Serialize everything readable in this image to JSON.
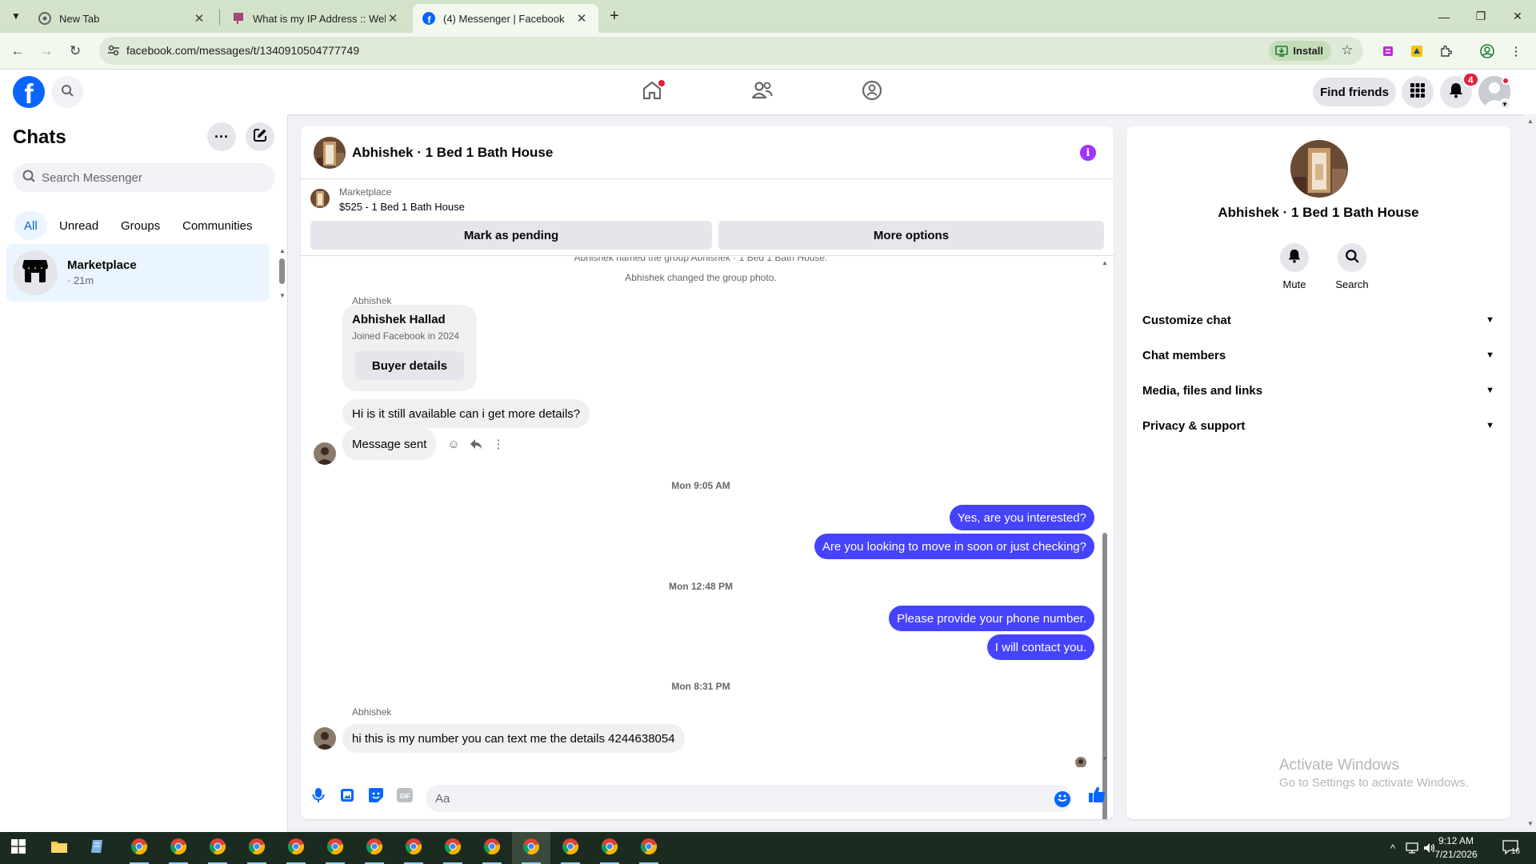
{
  "browser": {
    "tabs": [
      {
        "title": "New Tab",
        "icon": "chrome-icon"
      },
      {
        "title": "What is my IP Address :: WebBrowserTools",
        "icon": "webpage-icon"
      },
      {
        "title": "(4) Messenger | Facebook",
        "icon": "facebook-icon",
        "active": true
      }
    ],
    "url": "facebook.com/messages/t/1340910504777749",
    "install_label": "Install"
  },
  "fb_header": {
    "find_friends": "Find friends",
    "notification_count": "4"
  },
  "sidebar": {
    "title": "Chats",
    "search_placeholder": "Search Messenger",
    "filters": [
      "All",
      "Unread",
      "Groups",
      "Communities"
    ],
    "active_filter": "All",
    "chats": [
      {
        "name": "Marketplace",
        "time": "· 21m"
      }
    ]
  },
  "conversation": {
    "title": "Abhishek · 1 Bed 1 Bath House",
    "marketplace_label": "Marketplace",
    "listing": "$525 - 1 Bed 1 Bath House",
    "mark_pending": "Mark as pending",
    "more_options": "More options",
    "system_cut": "Abhishek named the group Abhishek · 1 Bed 1 Bath House.",
    "system_photo": "Abhishek changed the group photo.",
    "sender_1": "Abhishek",
    "profile_card": {
      "name": "Abhishek Hallad",
      "joined": "Joined Facebook in 2024",
      "button": "Buyer details"
    },
    "msg_in_1": "Hi is it still available can i get more details?",
    "msg_in_2": "Message sent",
    "time_1": "Mon 9:05 AM",
    "msg_out_1": "Yes, are you interested?",
    "msg_out_2": "Are you looking to move in soon or just checking?",
    "time_2": "Mon 12:48 PM",
    "msg_out_3": "Please provide your phone number.",
    "msg_out_4": "I will contact you.",
    "time_3": "Mon 8:31 PM",
    "sender_2": "Abhishek",
    "msg_in_3": "hi this is my number you can text me the details 4244638054",
    "composer_placeholder": "Aa"
  },
  "info_panel": {
    "name": "Abhishek · 1 Bed 1 Bath House",
    "mute": "Mute",
    "search": "Search",
    "sections": [
      "Customize chat",
      "Chat members",
      "Media, files and links",
      "Privacy & support"
    ]
  },
  "watermark": {
    "line1": "Activate Windows",
    "line2": "Go to Settings to activate Windows."
  },
  "taskbar": {
    "time": "9:12 AM",
    "date": "7/21/2026",
    "notif_count": "16"
  },
  "colors": {
    "fb_blue": "#0866ff",
    "outgoing_bubble": "#4643ff",
    "info_purple": "#a033ff",
    "badge_red": "#e41e3f"
  }
}
